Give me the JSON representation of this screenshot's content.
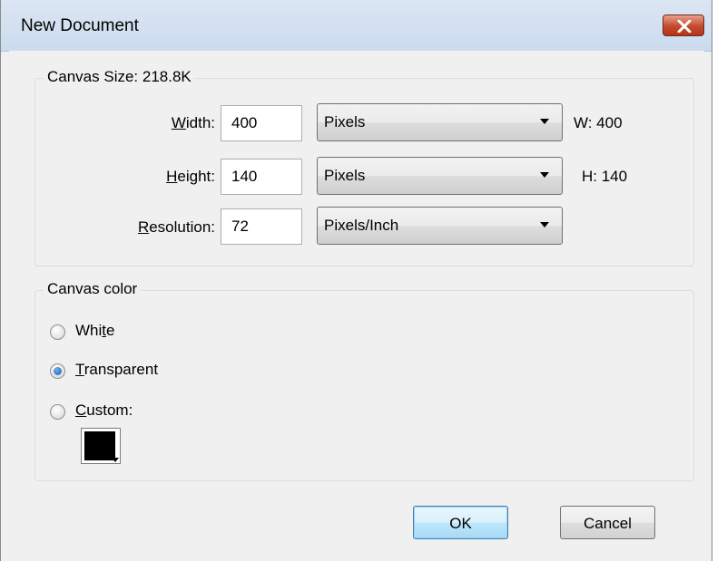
{
  "window": {
    "title": "New Document"
  },
  "canvas_size": {
    "legend": "Canvas Size: 218.8K",
    "rows": [
      {
        "label": "Width:",
        "value": "400",
        "unit": "Pixels",
        "readout": "W: 400"
      },
      {
        "label": "Height:",
        "value": "140",
        "unit": "Pixels",
        "readout": "H: 140"
      },
      {
        "label": "Resolution:",
        "value": "72",
        "unit": "Pixels/Inch",
        "readout": ""
      }
    ]
  },
  "canvas_color": {
    "legend": "Canvas color",
    "options": [
      {
        "label": "White",
        "checked": false
      },
      {
        "label": "Transparent",
        "checked": true
      },
      {
        "label": "Custom:",
        "checked": false
      }
    ],
    "custom_color": "#000000"
  },
  "buttons": {
    "ok": "OK",
    "cancel": "Cancel"
  },
  "icons": {
    "close": "close-icon",
    "swatch_dropdown": "chevron-down-icon"
  }
}
